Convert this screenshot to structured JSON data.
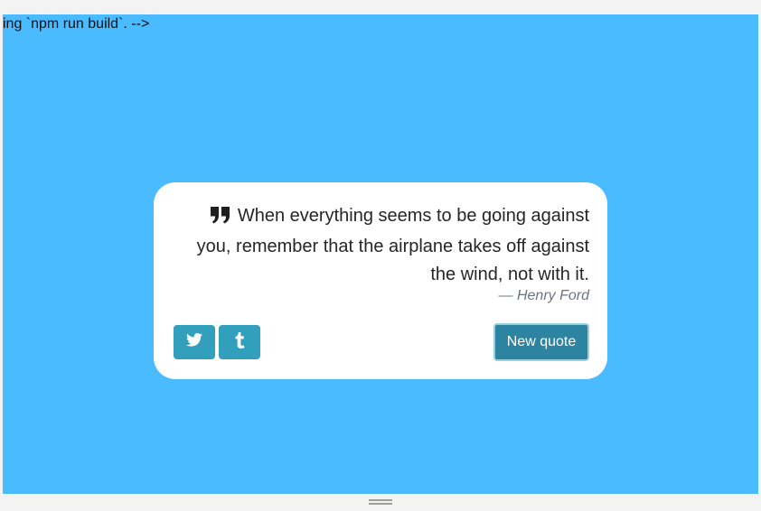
{
  "page": {
    "stray_text": "ing `npm run build`. -->"
  },
  "quote": {
    "text": "When everything seems to be going against you, remember that the airplane takes off against the wind, not with it.",
    "author": "— Henry Ford",
    "icon": "quote-right-icon"
  },
  "actions": {
    "twitter_icon": "twitter-icon",
    "tumblr_icon": "tumblr-icon",
    "new_quote_label": "New quote"
  },
  "colors": {
    "background": "#4bbbff",
    "card": "#ffffff",
    "share_button": "#32a0bd",
    "primary_button": "#2c84a0"
  }
}
